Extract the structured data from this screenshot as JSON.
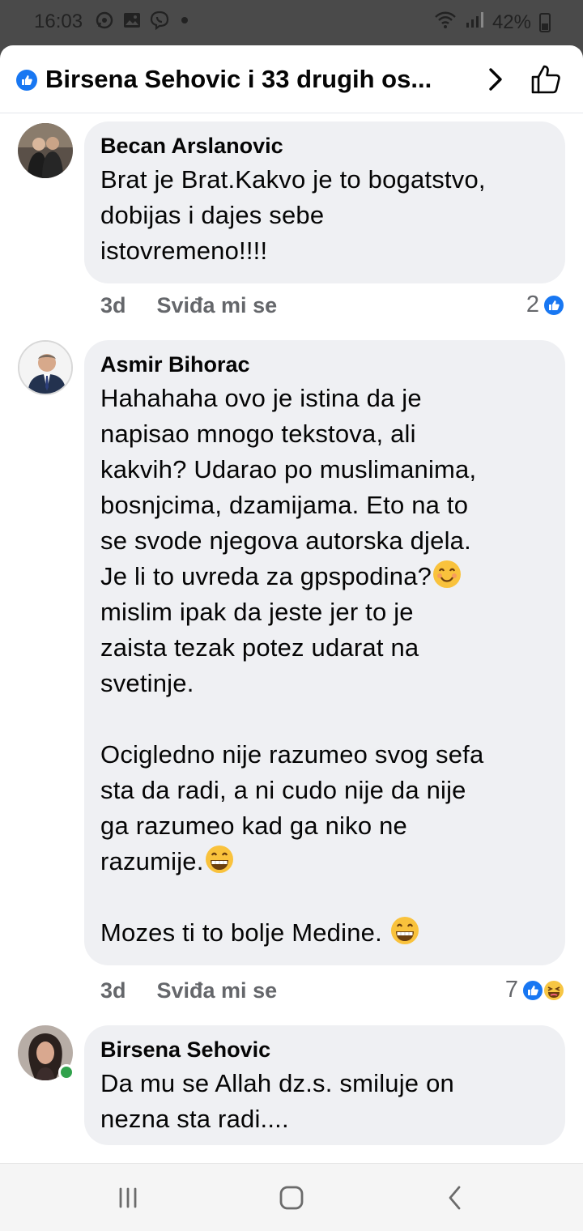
{
  "status_bar": {
    "time": "16:03",
    "battery": "42%",
    "icons": [
      "whatsapp-icon",
      "gallery-icon",
      "viber-icon",
      "dot-icon",
      "wifi-icon",
      "signal-icon",
      "battery-icon"
    ]
  },
  "header": {
    "title": "Birsena Sehovic i 33 drugih os...",
    "icons": [
      "like-badge-icon",
      "chevron-right-icon",
      "thumbs-up-icon"
    ]
  },
  "comments": [
    {
      "author": "Becan Arslanovic",
      "text": "Brat je Brat.Kakvo je to bogatstvo,\ndobijas i dajes sebe\nistovremeno!!!!",
      "time": "3d",
      "like_label": "Sviđa mi se",
      "reaction_count": "2",
      "reactions": [
        "like"
      ]
    },
    {
      "author": "Asmir Bihorac",
      "text_part1": "Hahahaha ovo je istina da je\nnapisao mnogo tekstova, ali\nkakvih? Udarao po muslimanima,\nbosnjcima, dzamijama. Eto na to\nse svode njegova autorska djela.\nJe li to uvreda za gpspodina?",
      "text_part2": "\nmislim ipak da jeste jer to je\nzaista tezak potez udarat na\nsvetinje.\n\nOcigledno nije razumeo svog sefa\nsta da radi, a ni cudo nije da nije\nga razumeo kad ga niko ne\nrazumije.",
      "text_part3": "\n\nMozes ti to bolje Medine. ",
      "time": "3d",
      "like_label": "Sviđa mi se",
      "reaction_count": "7",
      "reactions": [
        "like",
        "haha"
      ]
    },
    {
      "author": "Birsena Sehovic",
      "text": "Da mu se Allah dz.s. smiluje on\nnezna sta radi....",
      "online": true
    }
  ],
  "colors": {
    "accent": "#1877f2",
    "bubble": "#eff0f3",
    "meta": "#65676b",
    "online": "#31a24c"
  },
  "nav": {
    "icons": [
      "recent-apps-icon",
      "home-icon",
      "back-icon"
    ]
  }
}
